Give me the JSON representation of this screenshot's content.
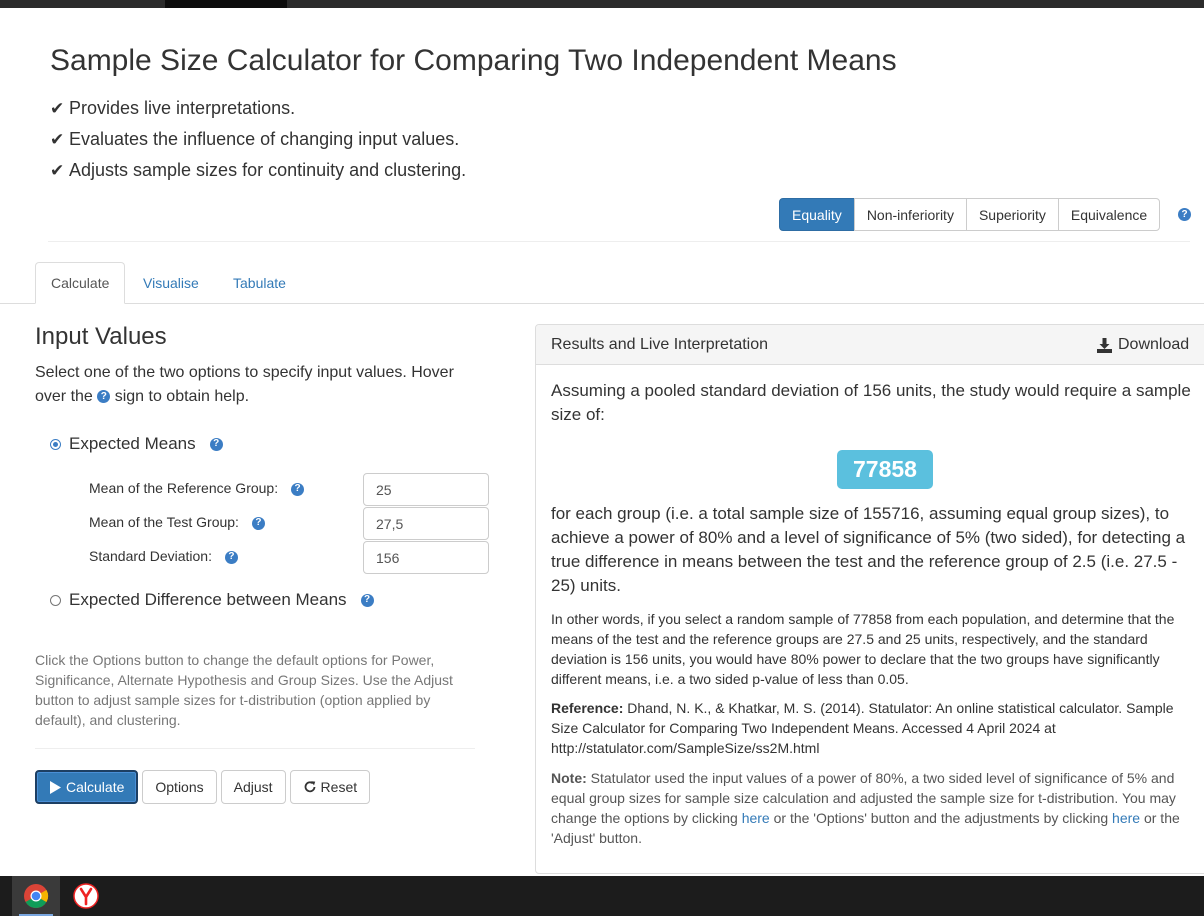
{
  "header": {
    "title": "Sample Size Calculator for Comparing Two Independent Means",
    "features": [
      "Provides live interpretations.",
      "Evaluates the influence of changing input values.",
      "Adjusts sample sizes for continuity and clustering."
    ]
  },
  "hypothesis_types": {
    "options": [
      "Equality",
      "Non-inferiority",
      "Superiority",
      "Equivalence"
    ],
    "selected": "Equality"
  },
  "tabs": [
    {
      "label": "Calculate",
      "active": true
    },
    {
      "label": "Visualise",
      "active": false
    },
    {
      "label": "Tabulate",
      "active": false
    }
  ],
  "inputs": {
    "heading": "Input Values",
    "intro_before": "Select one of the two options to specify input values. Hover over the",
    "intro_after": "sign to obtain help.",
    "option_means": "Expected Means",
    "option_difference": "Expected Difference between Means",
    "fields": [
      {
        "label": "Mean of the Reference Group:",
        "value": "25"
      },
      {
        "label": "Mean of the Test Group:",
        "value": "27,5"
      },
      {
        "label": "Standard Deviation:",
        "value": "156"
      }
    ],
    "hint": "Click the Options button to change the default options for Power, Significance, Alternate Hypothesis and Group Sizes. Use the Adjust button to adjust sample sizes for t-distribution (option applied by default), and clustering."
  },
  "actions": {
    "calculate": "Calculate",
    "options": "Options",
    "adjust": "Adjust",
    "reset": "Reset"
  },
  "results": {
    "panel_title": "Results and Live Interpretation",
    "download": "Download",
    "lead": "Assuming a pooled standard deviation of 156 units, the study would require a sample size of:",
    "sample_size": "77858",
    "main": "for each group (i.e. a total sample size of 155716, assuming equal group sizes), to achieve a power of 80% and a level of significance of 5% (two sided), for detecting a true difference in means between the test and the reference group of 2.5 (i.e. 27.5 - 25) units.",
    "other_words": "In other words, if you select a random sample of 77858 from each population, and determine that the means of the test and the reference groups are 27.5 and 25 units, respectively, and the standard deviation is 156 units, you would have 80% power to declare that the two groups have significantly different means, i.e. a two sided p-value of less than 0.05.",
    "reference_label": "Reference:",
    "reference_text": "Dhand, N. K., & Khatkar, M. S. (2014). Statulator: An online statistical calculator. Sample Size Calculator for Comparing Two Independent Means. Accessed 4 April 2024 at http://statulator.com/SampleSize/ss2M.html",
    "note_label": "Note:",
    "note_part1": "Statulator used the input values of a power of 80%, a two sided level of significance of 5% and equal group sizes for sample size calculation and adjusted the sample size for t-distribution. You may change the options by clicking",
    "note_link1": "here",
    "note_part2": "or the 'Options' button and the adjustments by clicking",
    "note_link2": "here",
    "note_part3": "or the 'Adjust' button."
  },
  "taskbar": {
    "apps": [
      "chrome-icon",
      "yandex-browser-icon"
    ]
  },
  "colors": {
    "primary": "#337ab7",
    "info_badge": "#5bc0de",
    "link": "#337ab7",
    "help_icon": "#3b7dc4"
  }
}
